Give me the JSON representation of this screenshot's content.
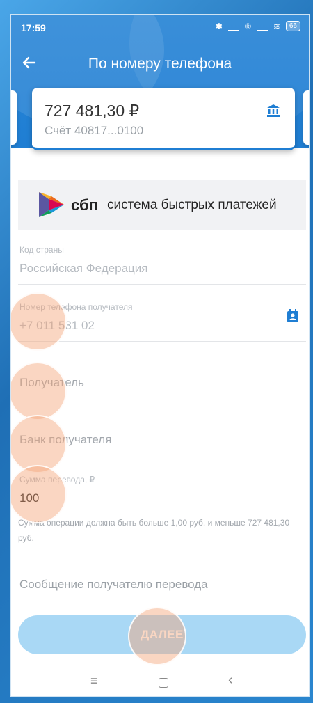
{
  "status": {
    "time": "17:59",
    "battery": "66"
  },
  "appbar": {
    "title": "По номеру телефона"
  },
  "account": {
    "amount": "727 481,30 ₽",
    "number": "Счёт 40817...0100"
  },
  "sbp": {
    "short": "сбп",
    "full": "система быстрых платежей"
  },
  "form": {
    "country": {
      "label": "Код страны",
      "value": "Российская Федерация"
    },
    "phone": {
      "label": "Номер телефона получателя",
      "value": "+7 011 531 02"
    },
    "recipient": {
      "placeholder": "Получатель"
    },
    "bank": {
      "placeholder": "Банк получателя"
    },
    "amount": {
      "label": "Сумма перевода, ₽",
      "value": "100"
    },
    "hint": "Сумма операции должна быть больше 1,00 руб. и меньше 727 481,30 руб.",
    "message": {
      "placeholder": "Сообщение получателю перевода"
    }
  },
  "buttons": {
    "next": "ДАЛЕЕ"
  },
  "colors": {
    "primary": "#1f7ed3",
    "button_disabled": "#a9d8f5",
    "muted_text": "#b6bbc1"
  }
}
